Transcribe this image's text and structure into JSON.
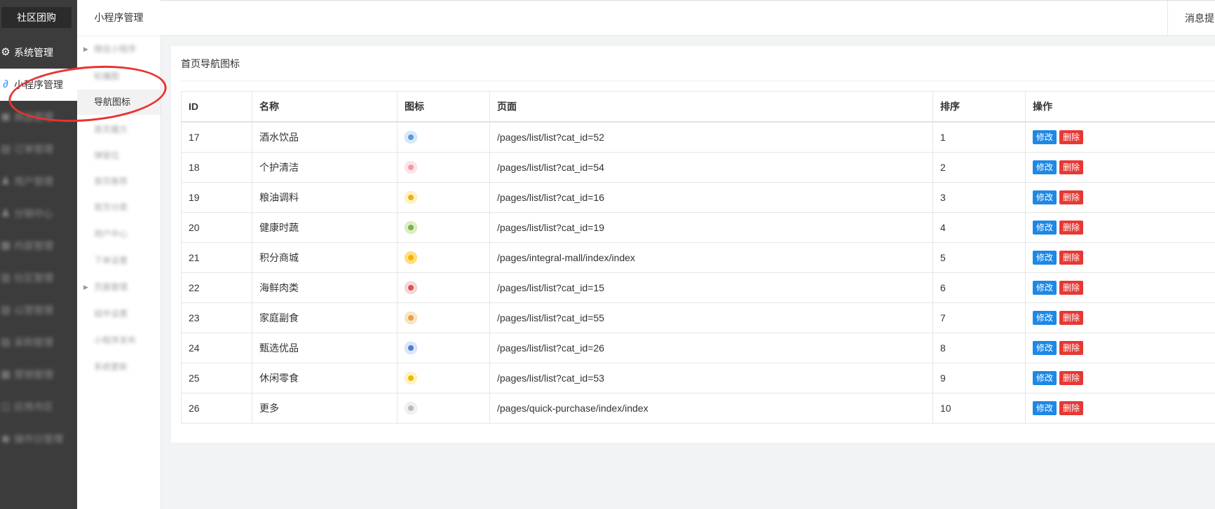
{
  "sidebar": {
    "brand": "社区团购",
    "items": [
      {
        "label": "系统管理",
        "icon": "gear-icon",
        "glyph": "⚙",
        "state": "normal"
      },
      {
        "label": "小程序管理",
        "icon": "link-icon",
        "glyph": "∂",
        "state": "active"
      },
      {
        "label": "商品管理",
        "icon": "box-icon",
        "glyph": "▣",
        "state": "blur"
      },
      {
        "label": "订单管理",
        "icon": "order-icon",
        "glyph": "▤",
        "state": "blur"
      },
      {
        "label": "用户管理",
        "icon": "user-icon",
        "glyph": "♟",
        "state": "blur"
      },
      {
        "label": "分销中心",
        "icon": "user-icon",
        "glyph": "♟",
        "state": "blur"
      },
      {
        "label": "内容管理",
        "icon": "doc-icon",
        "glyph": "▦",
        "state": "blur"
      },
      {
        "label": "社区管理",
        "icon": "home-icon",
        "glyph": "▥",
        "state": "blur"
      },
      {
        "label": "以营管理",
        "icon": "shop-icon",
        "glyph": "▧",
        "state": "blur"
      },
      {
        "label": "采购管理",
        "icon": "cart-icon",
        "glyph": "▨",
        "state": "blur"
      },
      {
        "label": "营销管理",
        "icon": "gift-icon",
        "glyph": "▩",
        "state": "blur"
      },
      {
        "label": "应用市区",
        "icon": "app-icon",
        "glyph": "◫",
        "state": "blur"
      },
      {
        "label": "操作日管理",
        "icon": "log-icon",
        "glyph": "◉",
        "state": "blur"
      }
    ]
  },
  "submenu": {
    "title": "小程序管理",
    "items": [
      {
        "label": "微信小程序",
        "state": "blur",
        "arrow": true
      },
      {
        "label": "轮播图",
        "state": "blur",
        "arrow": false
      },
      {
        "label": "导航图标",
        "state": "active",
        "arrow": false
      },
      {
        "label": "首页魔方",
        "state": "blur",
        "arrow": false
      },
      {
        "label": "弹窗位",
        "state": "blur",
        "arrow": false
      },
      {
        "label": "首页推荐",
        "state": "blur",
        "arrow": false
      },
      {
        "label": "首页分类",
        "state": "blur",
        "arrow": false
      },
      {
        "label": "用户中心",
        "state": "blur",
        "arrow": false
      },
      {
        "label": "下单设置",
        "state": "blur",
        "arrow": false
      },
      {
        "label": "页面管理",
        "state": "blur",
        "arrow": true
      },
      {
        "label": "组件设置",
        "state": "blur",
        "arrow": false
      },
      {
        "label": "小程序发布",
        "state": "blur",
        "arrow": false
      },
      {
        "label": "系统更新",
        "state": "blur",
        "arrow": false
      }
    ]
  },
  "topbar": {
    "notice": "消息提"
  },
  "card": {
    "title": "首页导航图标"
  },
  "table": {
    "headers": [
      "ID",
      "名称",
      "图标",
      "页面",
      "排序",
      "操作"
    ],
    "edit_label": "修改",
    "delete_label": "删除",
    "rows": [
      {
        "id": "17",
        "name": "酒水饮品",
        "icon_color": "#5b9bd5",
        "icon_bg": "#d9e8fb",
        "page": "/pages/list/list?cat_id=52",
        "sort": "1"
      },
      {
        "id": "18",
        "name": "个护清洁",
        "icon_color": "#f29aa8",
        "icon_bg": "#fde4e8",
        "page": "/pages/list/list?cat_id=54",
        "sort": "2"
      },
      {
        "id": "19",
        "name": "粮油调料",
        "icon_color": "#e8b11b",
        "icon_bg": "#fff1c2",
        "page": "/pages/list/list?cat_id=16",
        "sort": "3"
      },
      {
        "id": "20",
        "name": "健康时蔬",
        "icon_color": "#7cb342",
        "icon_bg": "#dcedc8",
        "page": "/pages/list/list?cat_id=19",
        "sort": "4"
      },
      {
        "id": "21",
        "name": "积分商城",
        "icon_color": "#f5b400",
        "icon_bg": "#ffe082",
        "page": "/pages/integral-mall/index/index",
        "sort": "5"
      },
      {
        "id": "22",
        "name": "海鲜肉类",
        "icon_color": "#d9534f",
        "icon_bg": "#f8d7da",
        "page": "/pages/list/list?cat_id=15",
        "sort": "6"
      },
      {
        "id": "23",
        "name": "家庭副食",
        "icon_color": "#e6a04a",
        "icon_bg": "#fbe3c4",
        "page": "/pages/list/list?cat_id=55",
        "sort": "7"
      },
      {
        "id": "24",
        "name": "甄选优品",
        "icon_color": "#4a7fd4",
        "icon_bg": "#dbe6f8",
        "page": "/pages/list/list?cat_id=26",
        "sort": "8"
      },
      {
        "id": "25",
        "name": "休闲零食",
        "icon_color": "#f2b705",
        "icon_bg": "#fff3c4",
        "page": "/pages/list/list?cat_id=53",
        "sort": "9"
      },
      {
        "id": "26",
        "name": "更多",
        "icon_color": "#bbbbbb",
        "icon_bg": "#f0f0f0",
        "page": "/pages/quick-purchase/index/index",
        "sort": "10"
      }
    ]
  },
  "colors": {
    "sidebar_bg": "#3c3c3c",
    "edit_button": "#1e88e5",
    "delete_button": "#e53935",
    "annotation": "#e8332f"
  }
}
